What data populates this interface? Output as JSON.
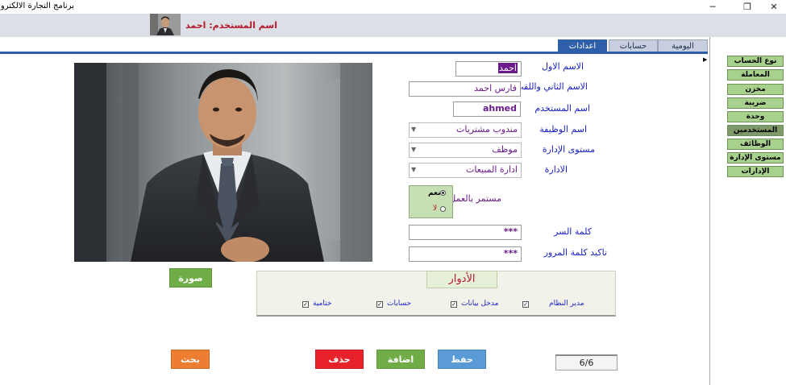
{
  "window": {
    "title": "برنامج التجارة الالكترونية",
    "minimize_glyph": "─",
    "restore_glyph": "❐",
    "close_glyph": "✕"
  },
  "header": {
    "user_label": "اسم المستخدم: احمد"
  },
  "tabs": [
    {
      "label": "اليومية",
      "active": false
    },
    {
      "label": "حسابات",
      "active": false
    },
    {
      "label": "اعدادات",
      "active": true
    }
  ],
  "nav": {
    "items": [
      {
        "label": "نوع الحساب"
      },
      {
        "label": "المعاملة"
      },
      {
        "label": "مخزن"
      },
      {
        "label": "ضريبة"
      },
      {
        "label": "وحدة"
      },
      {
        "label": "المستخدمين"
      },
      {
        "label": "الوظائف"
      },
      {
        "label": "مستوى الإدارة"
      },
      {
        "label": "الإدارات"
      }
    ]
  },
  "form": {
    "first_name_label": "الاسم الاول",
    "first_name_value": "احمد",
    "second_name_label": "الاسم الثاني واللقب",
    "second_name_value": "فارس احمد",
    "username_label": "اسم المستخدم",
    "username_value": "ahmed",
    "job_label": "اسم الوظيفة",
    "job_value": "مندوب مشتريات",
    "level_label": "مستوى الإدارة",
    "level_value": "موظف",
    "department_label": "الادارة",
    "department_value": "ادارة المبيعات",
    "active_label": "مستمر بالعمل",
    "active_yes": "نعم",
    "active_no": "لا",
    "password_label": "كلمة السر",
    "password_value": "***",
    "confirm_label": "تاكيد كلمة المرور",
    "confirm_value": "***"
  },
  "buttons": {
    "photo": "صورة",
    "search": "بحث",
    "delete": "حذف",
    "add": "اضافة",
    "save": "حفظ"
  },
  "roles": {
    "title": "الأدوار",
    "items": [
      {
        "label": "مدير النظام",
        "checked": true
      },
      {
        "label": "مدخل بيانات",
        "checked": true
      },
      {
        "label": "حسابات",
        "checked": true
      },
      {
        "label": "ختامية",
        "checked": true
      }
    ]
  },
  "record_counter": "6/6",
  "colors": {
    "accent_blue": "#2f5fa8",
    "nav_green": "#a9d18e",
    "label_blue": "#1a22c4",
    "value_purple": "#6a1b8a",
    "alert_red": "#b5172b"
  }
}
